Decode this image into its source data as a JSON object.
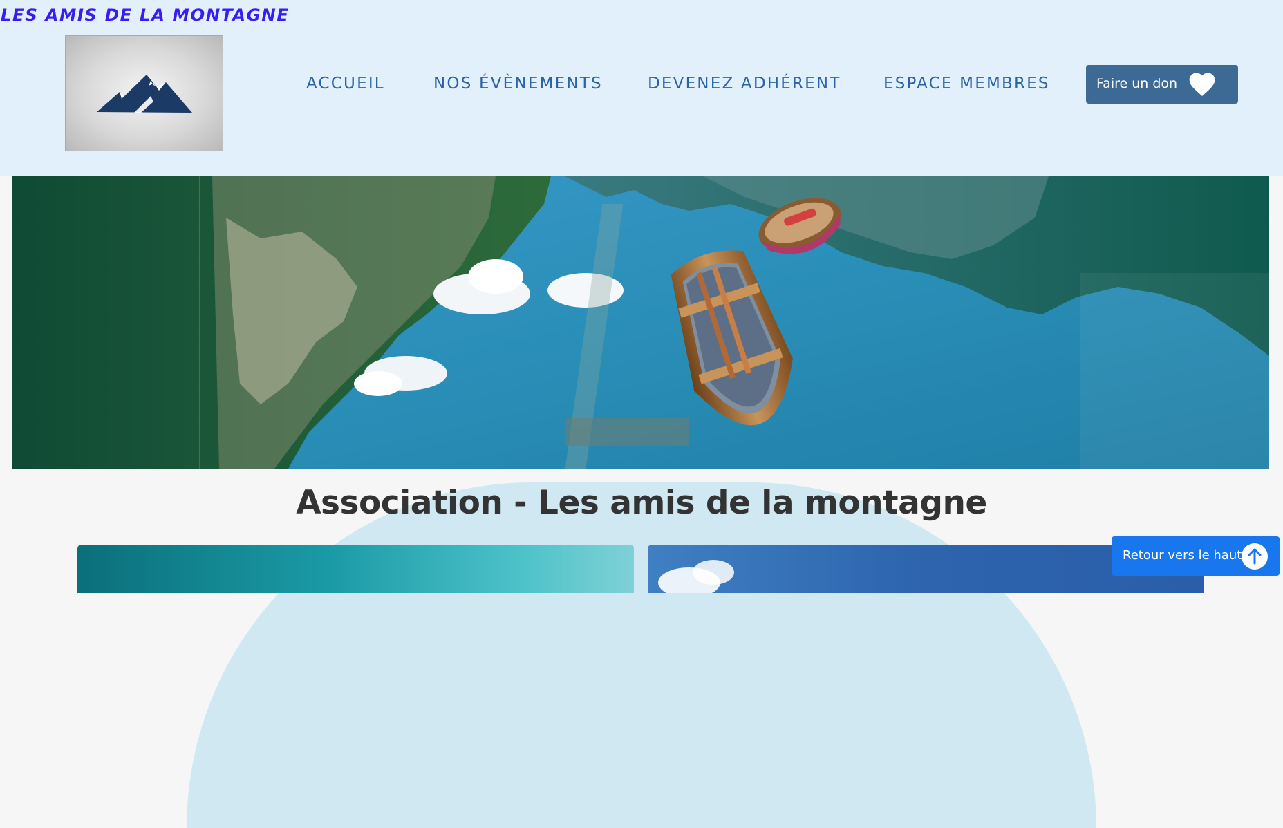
{
  "header": {
    "brand": "LES AMIS DE LA MONTAGNE",
    "logo_icon": "mountain-icon",
    "nav": [
      {
        "label": "ACCUEIL"
      },
      {
        "label": "NOS ÉVÈNEMENTS"
      },
      {
        "label": "DEVENEZ ADHÉRENT"
      },
      {
        "label": "ESPACE MEMBRES"
      }
    ],
    "donate": {
      "label": "Faire un don",
      "icon": "heart-icon"
    }
  },
  "hero": {
    "image": "lake-with-rowing-boats-and-mountains"
  },
  "main": {
    "title": "Association - Les amis de la montagne"
  },
  "back_to_top": {
    "label": "Retour vers le haut",
    "icon": "arrow-up-icon"
  },
  "colors": {
    "header_bg": "#e2f0fb",
    "brand": "#3a1cf0",
    "nav_text": "#2b63a8",
    "donate_bg": "#3d6a94",
    "back_top_bg": "#1877ee",
    "arch_bg": "#cfe8f1",
    "title_text": "#333333"
  }
}
